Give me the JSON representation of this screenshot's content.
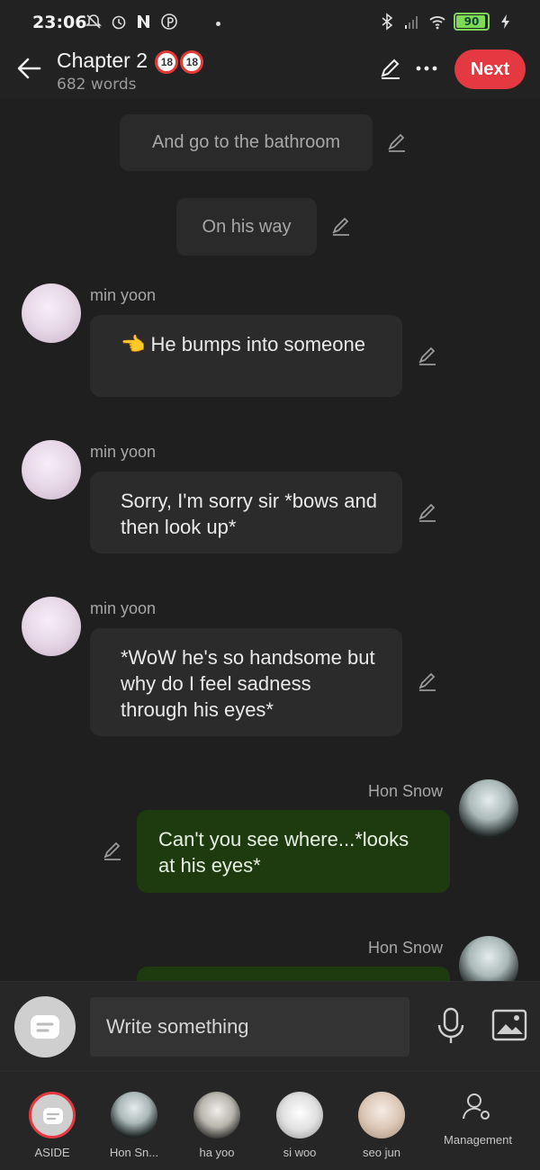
{
  "status_bar": {
    "time": "23:06",
    "battery": "90",
    "icons": [
      "bell-muted-icon",
      "alarm-icon",
      "n-app-icon",
      "pinterest-icon",
      "bluetooth-icon",
      "signal-icon",
      "wifi-icon",
      "battery-icon",
      "charging-icon"
    ]
  },
  "header": {
    "title": "Chapter 2",
    "badges": [
      "18",
      "18"
    ],
    "subtitle": "682 words",
    "next_label": "Next"
  },
  "messages": [
    {
      "type": "narration",
      "text": "And go to the bathroom"
    },
    {
      "type": "narration",
      "text": "On his way"
    },
    {
      "type": "character",
      "speaker": "min yoon",
      "text": "👈 He bumps into someone"
    },
    {
      "type": "character",
      "speaker": "min yoon",
      "text": "Sorry, I'm sorry sir *bows and then look up*"
    },
    {
      "type": "character",
      "speaker": "min yoon",
      "text": "*WoW he's so handsome but why do I feel sadness through his eyes*"
    },
    {
      "type": "character",
      "speaker": "Hon Snow",
      "text": "Can't you see where...*looks at his eyes*"
    },
    {
      "type": "character",
      "speaker": "Hon Snow",
      "text": ""
    }
  ],
  "input": {
    "placeholder": "Write something"
  },
  "tabs": [
    {
      "label": "ASIDE"
    },
    {
      "label": "Hon Sn..."
    },
    {
      "label": "ha yoo"
    },
    {
      "label": "si woo"
    },
    {
      "label": "seo jun"
    },
    {
      "label": "Management"
    }
  ],
  "colors": {
    "accent": "#e53942",
    "background": "#1f1f1f",
    "bubble": "#2b2b2b",
    "bubble_self": "#1e3a0f"
  }
}
